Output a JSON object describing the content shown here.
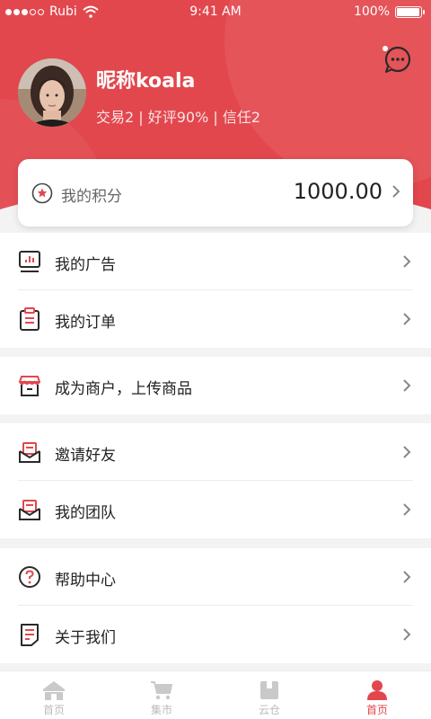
{
  "status_bar": {
    "carrier": "Rubi",
    "time": "9:41 AM",
    "battery": "100%"
  },
  "profile": {
    "nickname": "昵称koala",
    "stats": "交易2 | 好评90% | 信任2"
  },
  "points": {
    "label": "我的积分",
    "value": "1000.00"
  },
  "menu": {
    "ads": "我的广告",
    "orders": "我的订单",
    "merchant": "成为商户，上传商品",
    "invite": "邀请好友",
    "team": "我的团队",
    "help": "帮助中心",
    "about": "关于我们"
  },
  "tabs": [
    {
      "label": "首页",
      "icon": "home-icon",
      "active": false
    },
    {
      "label": "集市",
      "icon": "cart-icon",
      "active": false
    },
    {
      "label": "云仓",
      "icon": "warehouse-icon",
      "active": false
    },
    {
      "label": "首页",
      "icon": "user-icon",
      "active": true
    }
  ],
  "colors": {
    "accent": "#e2474d",
    "tab_inactive": "#bbbbbb",
    "background": "#f3f3f3"
  }
}
